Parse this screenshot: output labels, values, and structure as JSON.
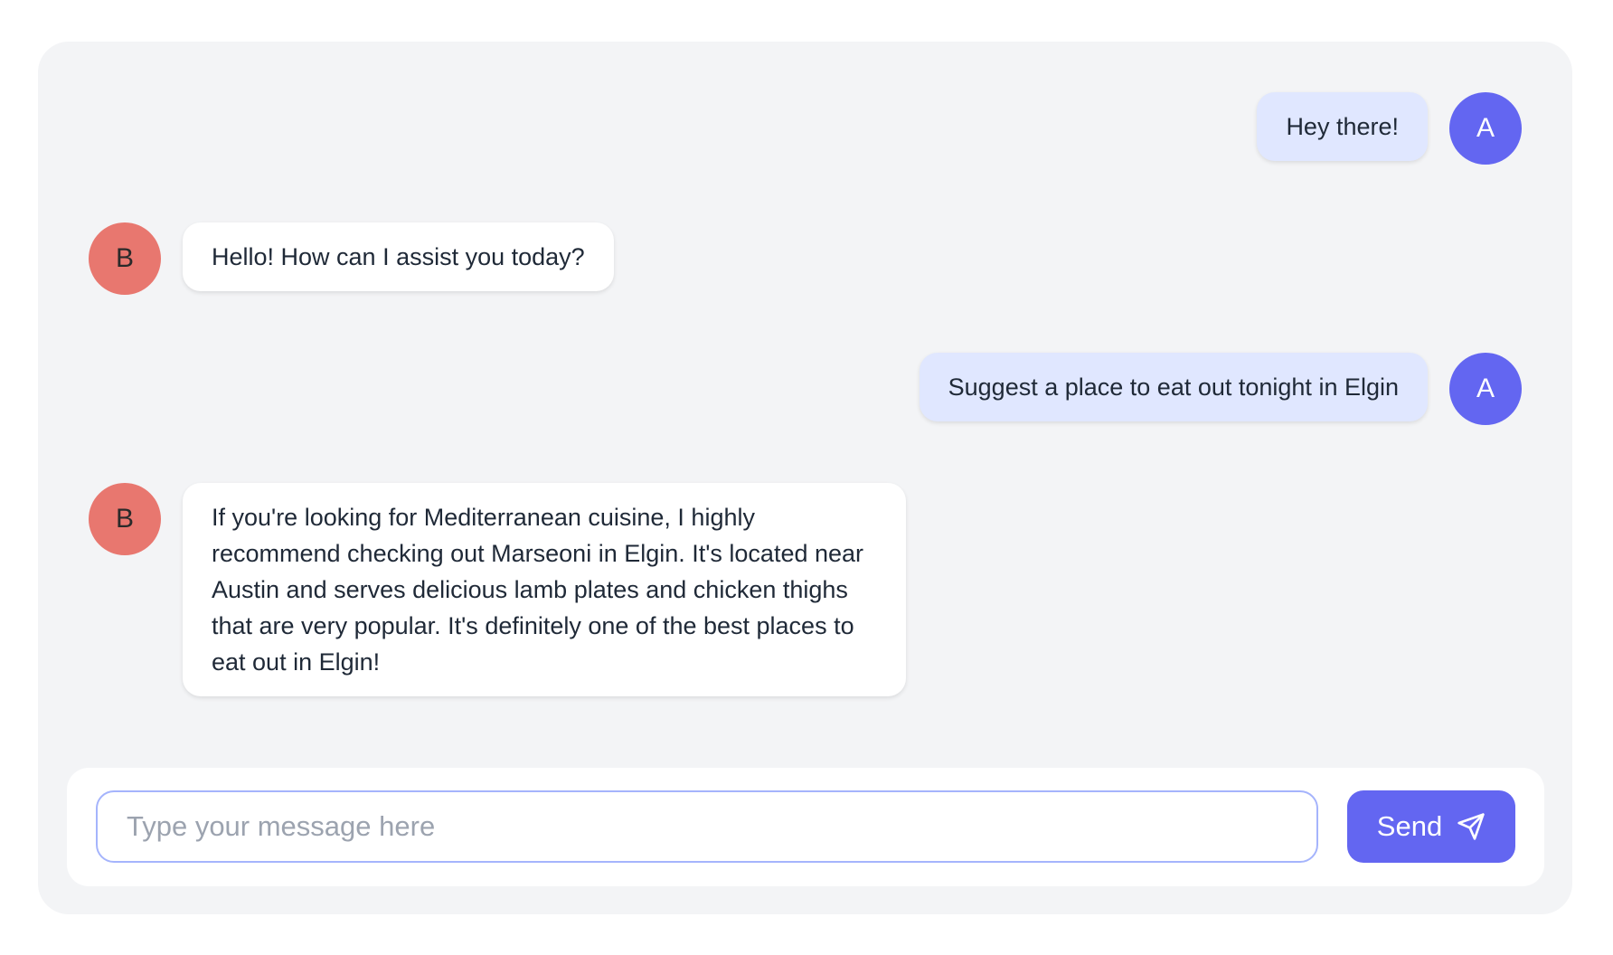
{
  "colors": {
    "user_avatar": "#6366f1",
    "bot_avatar": "#e8776f",
    "user_bubble": "#e0e7ff",
    "bot_bubble": "#ffffff",
    "accent": "#6366f1"
  },
  "messages": [
    {
      "sender": "user",
      "avatar": "A",
      "text": "Hey there!"
    },
    {
      "sender": "bot",
      "avatar": "B",
      "text": "Hello! How can I assist you today?"
    },
    {
      "sender": "user",
      "avatar": "A",
      "text": "Suggest a place to eat out tonight in Elgin"
    },
    {
      "sender": "bot",
      "avatar": "B",
      "text": "If you're looking for Mediterranean cuisine, I highly recommend checking out Marseoni in Elgin. It's located near Austin and serves delicious lamb plates and chicken thighs that are very popular. It's definitely one of the best places to eat out in Elgin!"
    }
  ],
  "composer": {
    "placeholder": "Type your message here",
    "value": "",
    "send_label": "Send",
    "send_icon": "paper-plane-icon"
  }
}
